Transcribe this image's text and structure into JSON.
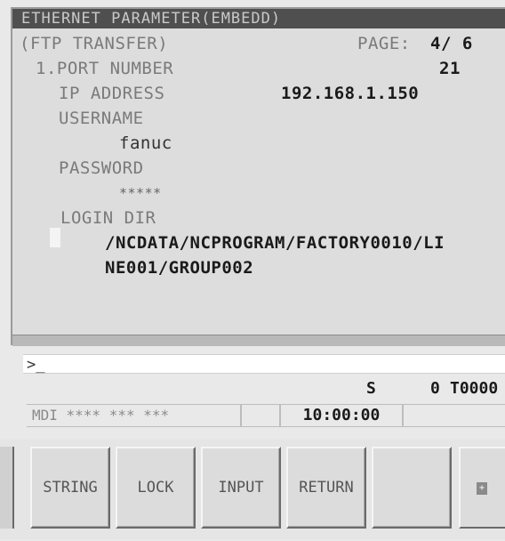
{
  "title": "ETHERNET PARAMETER(EMBEDD)",
  "section": "(FTP TRANSFER)",
  "page_label": "PAGE:",
  "page_value": "4/ 6",
  "params": {
    "port_number_label": "1.PORT NUMBER",
    "port_number_value": "21",
    "ip_address_label": "IP ADDRESS",
    "ip_address_value": "192.168.1.150",
    "username_label": "USERNAME",
    "username_value": "fanuc",
    "password_label": "PASSWORD",
    "password_value": "*****",
    "login_dir_label": "LOGIN DIR",
    "login_dir_line1": "/NCDATA/NCPROGRAM/FACTORY0010/LI",
    "login_dir_line2": "NE001/GROUP002"
  },
  "command_line": {
    "prompt": ">_"
  },
  "status": {
    "spindle_label": "S",
    "spindle_value": "0",
    "tool_value": "T0000",
    "mode_text": "MDI **** *** ***",
    "clock": "10:00:00"
  },
  "softkeys": [
    "STRING",
    "LOCK",
    "INPUT",
    "RETURN",
    ""
  ],
  "next_key_icon": "next-page-icon"
}
